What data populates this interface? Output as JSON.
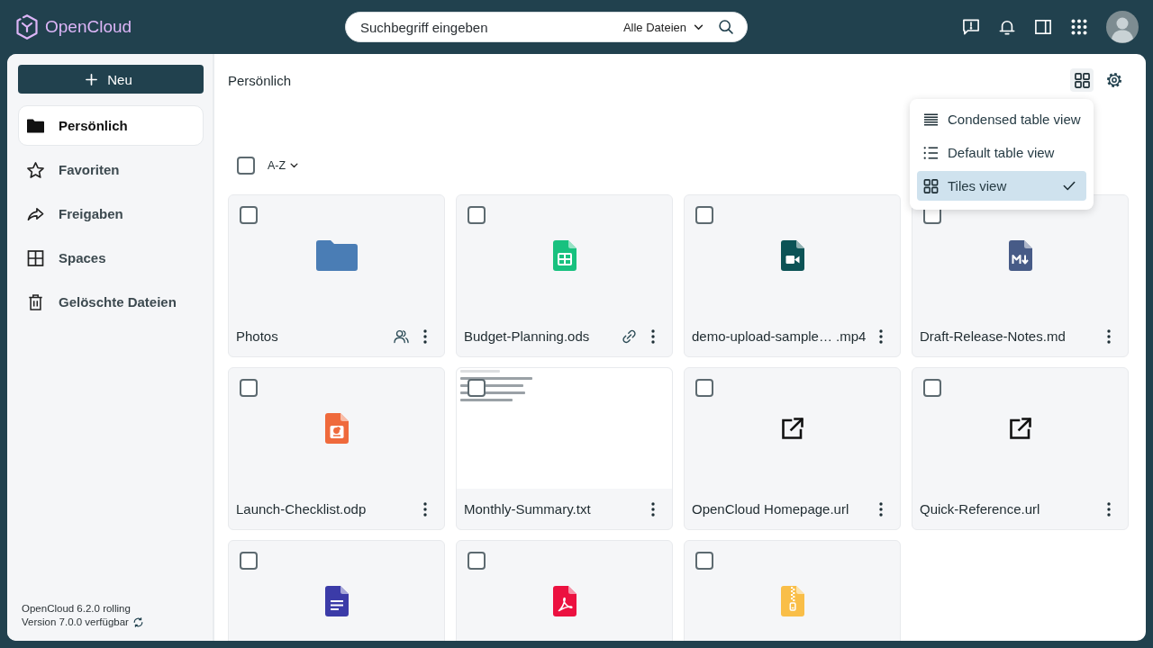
{
  "header": {
    "logo": "OpenCloud",
    "search": {
      "placeholder": "Suchbegriff eingeben",
      "scope": "Alle Dateien"
    }
  },
  "sidebar": {
    "new_button": "Neu",
    "items": [
      {
        "label": "Persönlich",
        "kind": "personal",
        "selected": true
      },
      {
        "label": "Favoriten",
        "kind": "favorites",
        "selected": false
      },
      {
        "label": "Freigaben",
        "kind": "shares",
        "selected": false
      },
      {
        "label": "Spaces",
        "kind": "spaces",
        "selected": false
      },
      {
        "label": "Gelöschte Dateien",
        "kind": "trash",
        "selected": false
      }
    ],
    "footer": {
      "version": "OpenCloud 6.2.0 rolling",
      "update": "Version 7.0.0 verfügbar"
    }
  },
  "main": {
    "breadcrumb": "Persönlich",
    "select_all": {
      "checked": false
    },
    "sort": "A-Z",
    "view_menu": {
      "items": [
        {
          "label": "Condensed table view",
          "kind": "condensed",
          "selected": false
        },
        {
          "label": "Default table view",
          "kind": "default",
          "selected": false
        },
        {
          "label": "Tiles view",
          "kind": "tiles",
          "selected": true
        }
      ]
    },
    "tiles": [
      {
        "name": "Photos",
        "kind": "folder",
        "checked": false,
        "shared": true,
        "has_link": false
      },
      {
        "name": "Budget-Planning.ods",
        "kind": "spreadsheet",
        "checked": false,
        "shared": false,
        "has_link": true
      },
      {
        "name": "demo-upload-sample… .mp4",
        "kind": "video",
        "checked": false,
        "shared": false,
        "has_link": false
      },
      {
        "name": "Draft-Release-Notes.md",
        "kind": "markdown",
        "checked": false,
        "shared": false,
        "has_link": false
      },
      {
        "name": "Launch-Checklist.odp",
        "kind": "presentation",
        "checked": false,
        "shared": false,
        "has_link": false
      },
      {
        "name": "Monthly-Summary.txt",
        "kind": "preview",
        "checked": false,
        "shared": false,
        "has_link": false
      },
      {
        "name": "OpenCloud Homepage.url",
        "kind": "weblink",
        "checked": false,
        "shared": false,
        "has_link": false
      },
      {
        "name": "Quick-Reference.url",
        "kind": "weblink",
        "checked": false,
        "shared": false,
        "has_link": false
      },
      {
        "kind": "document",
        "checked": false
      },
      {
        "kind": "pdf",
        "checked": false
      },
      {
        "kind": "archive",
        "checked": false
      }
    ]
  }
}
